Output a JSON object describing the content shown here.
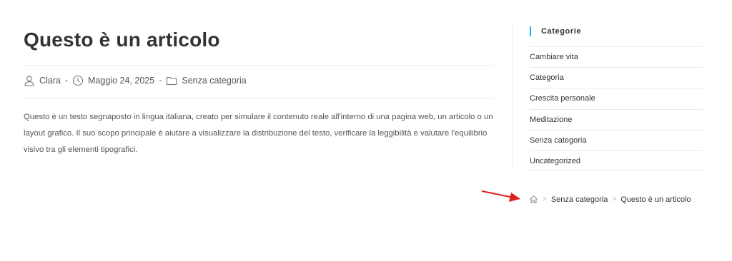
{
  "post": {
    "title": "Questo è un articolo",
    "author": "Clara",
    "date": "Maggio 24, 2025",
    "category": "Senza categoria",
    "separator": "-",
    "content": "Questo è un testo segnaposto in lingua italiana, creato per simulare il contenuto reale all'interno di una pagina web, un articolo o un layout grafico. Il suo scopo principale è aiutare a visualizzare la distribuzione del testo, verificare la leggibilità e valutare l'equilibrio visivo tra gli elementi tipografici."
  },
  "sidebar": {
    "widget_title": "Categorie",
    "categories": [
      "Cambiare vita",
      "Categoria",
      "Crescita personale",
      "Meditazione",
      "Senza categoria",
      "Uncategorized"
    ]
  },
  "breadcrumb": {
    "home_icon": "home-icon",
    "separator": ">",
    "items": [
      "Senza categoria",
      "Questo è un articolo"
    ]
  },
  "annotation": {
    "arrow_icon": "red-arrow",
    "arrow_color": "#e0201b"
  },
  "colors": {
    "accent": "#13aff0"
  }
}
